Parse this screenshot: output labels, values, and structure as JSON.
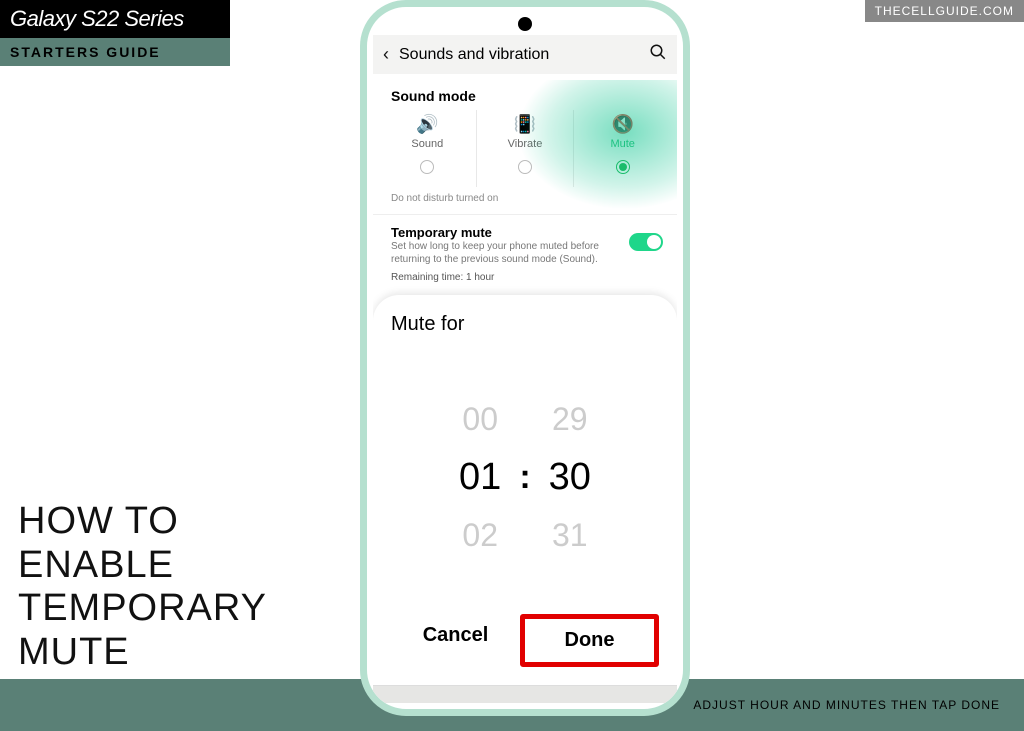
{
  "badge": {
    "top": "Galaxy S22 Series",
    "bottom": "STARTERS GUIDE"
  },
  "watermark": "THECELLGUIDE.COM",
  "bigtitle_lines": [
    "HOW TO",
    "ENABLE",
    "TEMPORARY",
    "MUTE"
  ],
  "caption": "ADJUST HOUR AND MINUTES THEN TAP DONE",
  "header": {
    "title": "Sounds and vibration"
  },
  "sound_mode": {
    "title": "Sound mode",
    "options": [
      {
        "label": "Sound",
        "icon": "🔊"
      },
      {
        "label": "Vibrate",
        "icon": "📳"
      },
      {
        "label": "Mute",
        "icon": "🔇"
      }
    ],
    "dnd_text": "Do not disturb turned on"
  },
  "temp_mute": {
    "title": "Temporary mute",
    "desc": "Set how long to keep your phone muted before returning to the previous sound mode (Sound).",
    "remaining": "Remaining time: 1 hour"
  },
  "sheet": {
    "title": "Mute for",
    "hour": {
      "prev": "00",
      "sel": "01",
      "next": "02"
    },
    "min": {
      "prev": "29",
      "sel": "30",
      "next": "31"
    },
    "colon": ":",
    "cancel": "Cancel",
    "done": "Done"
  }
}
